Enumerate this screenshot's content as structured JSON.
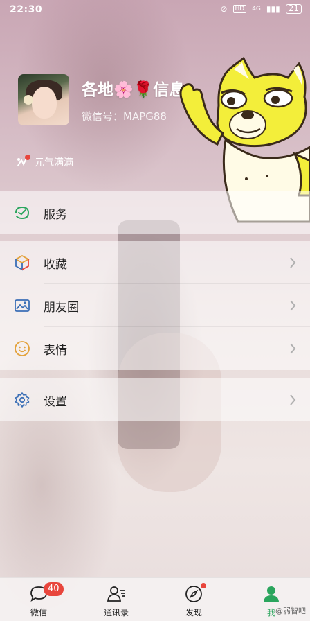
{
  "status_bar": {
    "time": "22:30",
    "hd_label": "HD",
    "network_label": "4G",
    "battery_level": "21"
  },
  "profile": {
    "nickname": "各地🌸🌹信息",
    "wechat_id": "微信号：MAPG88",
    "status_text": "元气满满"
  },
  "menu": {
    "services": "服务",
    "favorites": "收藏",
    "moments": "朋友圈",
    "stickers": "表情",
    "settings": "设置"
  },
  "tabbar": {
    "chats": "微信",
    "chats_badge": "40",
    "contacts": "通讯录",
    "discover": "发现",
    "me": "我",
    "active_tab": "me"
  },
  "watermark": "@弱智吧",
  "colors": {
    "accent_green": "#2aa55d",
    "badge_red": "#e8453c",
    "icon_blue": "#3b6fb6",
    "icon_orange": "#e3a23b"
  },
  "icons": {
    "services": "services-icon",
    "favorites": "favorites-cube-icon",
    "moments": "moments-image-icon",
    "stickers": "smiley-icon",
    "settings": "gear-icon"
  }
}
